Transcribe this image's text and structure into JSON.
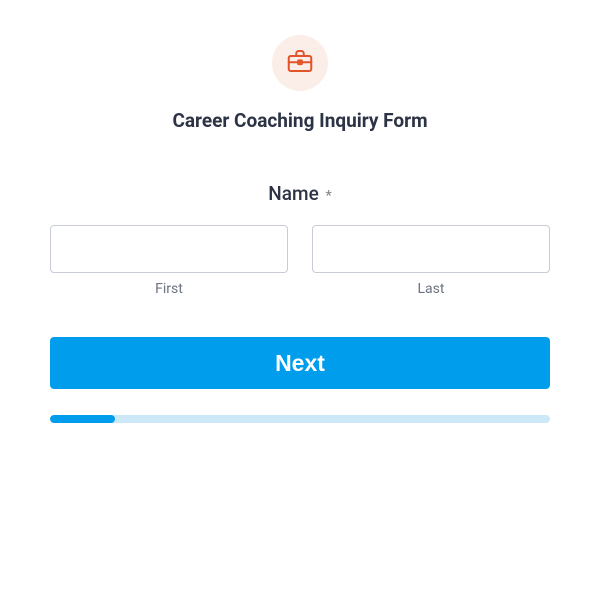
{
  "header": {
    "title": "Career Coaching Inquiry Form",
    "icon_name": "briefcase-icon"
  },
  "field": {
    "label": "Name",
    "required_marker": "*",
    "first_sublabel": "First",
    "last_sublabel": "Last",
    "first_value": "",
    "last_value": ""
  },
  "button": {
    "next_label": "Next"
  },
  "progress": {
    "percent": 13
  },
  "colors": {
    "accent": "#009ded",
    "icon_bg": "#fbeee8",
    "icon_stroke": "#e2542a"
  }
}
